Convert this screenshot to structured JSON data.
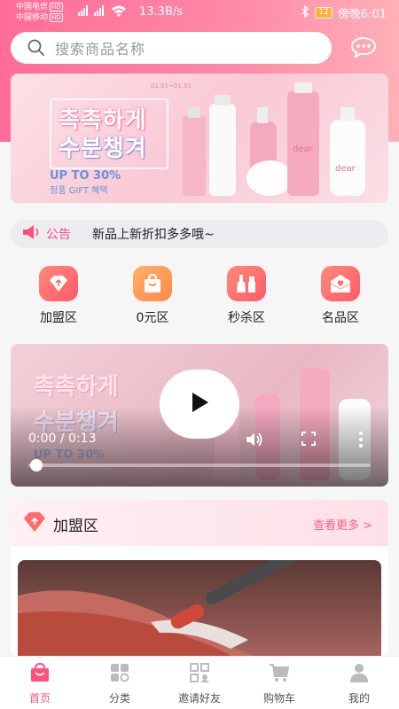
{
  "status_bar": {
    "carrier1": "中国电信",
    "carrier2": "中国移动",
    "hd": "HD",
    "net_speed": "13.3B/s",
    "battery": "12",
    "time": "傍晚6:01"
  },
  "search": {
    "placeholder": "搜索商品名称"
  },
  "banner": {
    "date": "01.01~01.31",
    "korean_line1": "촉촉하게",
    "korean_line2": "수분챙겨",
    "promo": "UP TO 30%",
    "gift": "정품 GIFT 혜택",
    "brand": "dear"
  },
  "notice": {
    "label": "公告",
    "text": "新品上新折扣多多哦~"
  },
  "categories": [
    {
      "label": "加盟区",
      "icon": "diamond-icon",
      "color": "#ff6a6a"
    },
    {
      "label": "0元区",
      "icon": "bag-icon",
      "color": "#ff9a5a"
    },
    {
      "label": "秒杀区",
      "icon": "cosmetics-icon",
      "color": "#ff6a6a"
    },
    {
      "label": "名品区",
      "icon": "envelope-heart-icon",
      "color": "#ff6a6a"
    }
  ],
  "video": {
    "current": "0:00",
    "duration": "0:13",
    "time_text": "0:00 / 0:13",
    "progress": 0
  },
  "section": {
    "title": "加盟区",
    "more": "查看更多 >"
  },
  "tabbar": [
    {
      "label": "首页",
      "icon": "home-bag-icon",
      "active": true
    },
    {
      "label": "分类",
      "icon": "category-icon",
      "active": false
    },
    {
      "label": "邀请好友",
      "icon": "qrcode-icon",
      "active": false
    },
    {
      "label": "购物车",
      "icon": "cart-icon",
      "active": false
    },
    {
      "label": "我的",
      "icon": "user-icon",
      "active": false
    }
  ],
  "colors": {
    "accent": "#ff4f7f",
    "header_gradient_start": "#ff6c97",
    "header_gradient_end": "#ffb0b8"
  }
}
